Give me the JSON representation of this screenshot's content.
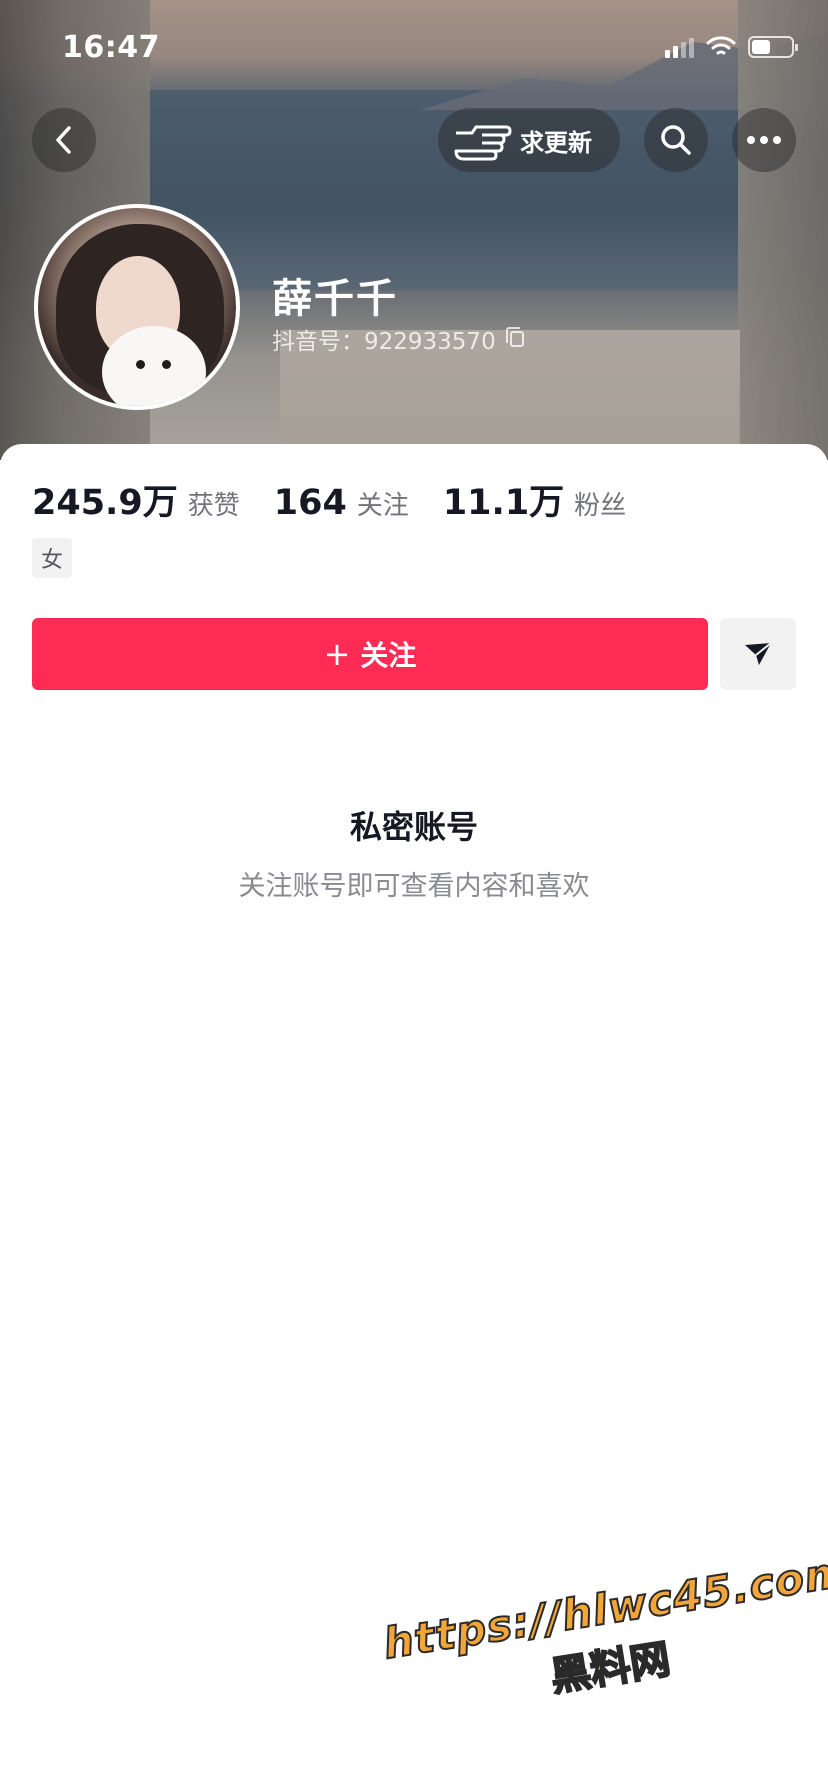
{
  "status_bar": {
    "time": "16:47"
  },
  "header": {
    "update_button_label": "求更新",
    "profile": {
      "name": "薛千千",
      "douyin_id": "抖音号：922933570"
    }
  },
  "stats": [
    {
      "value": "245.9万",
      "label": "获赞"
    },
    {
      "value": "164",
      "label": "关注"
    },
    {
      "value": "11.1万",
      "label": "粉丝"
    }
  ],
  "gender_tag": "女",
  "actions": {
    "follow_plus": "+",
    "follow_label": "关注"
  },
  "private_notice": {
    "title": "私密账号",
    "description": "关注账号即可查看内容和喜欢"
  },
  "watermark": {
    "url": "https://hlwc45.com",
    "name": "黑料网"
  },
  "colors": {
    "accent": "#fe2c55",
    "watermark": "#f2a63a"
  }
}
